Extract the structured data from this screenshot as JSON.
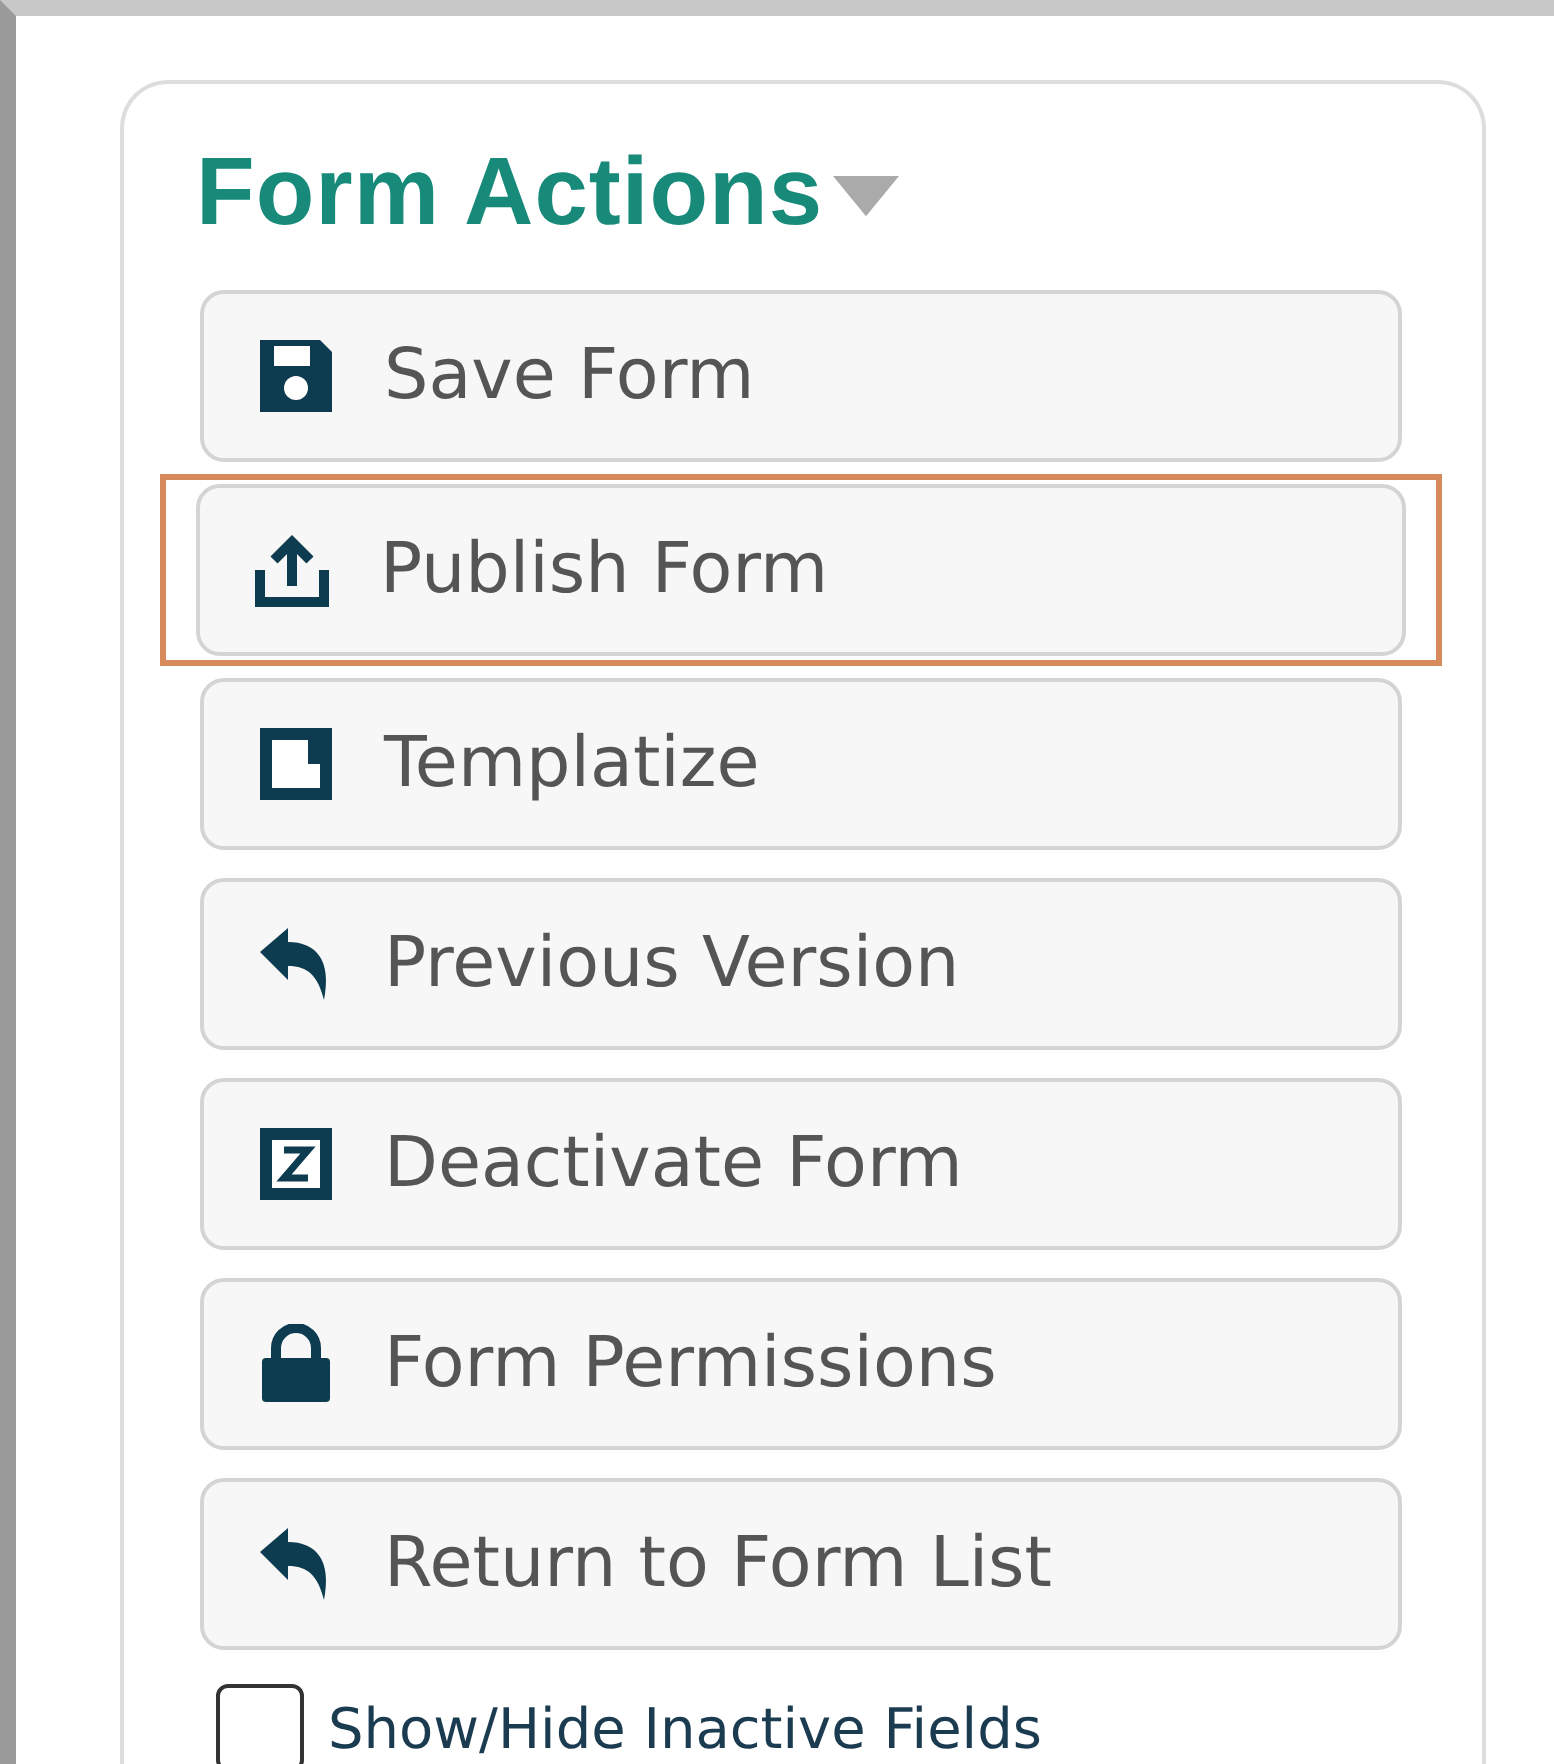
{
  "panel": {
    "title": "Form Actions",
    "buttons": [
      {
        "label": "Save Form",
        "kind": "save",
        "highlighted": false
      },
      {
        "label": "Publish Form",
        "kind": "publish",
        "highlighted": true
      },
      {
        "label": "Templatize",
        "kind": "template",
        "highlighted": false
      },
      {
        "label": "Previous Version",
        "kind": "revert",
        "highlighted": false
      },
      {
        "label": "Deactivate Form",
        "kind": "deactivate",
        "highlighted": false
      },
      {
        "label": "Form Permissions",
        "kind": "permissions",
        "highlighted": false
      },
      {
        "label": "Return to Form List",
        "kind": "revert",
        "highlighted": false
      }
    ],
    "checkbox": {
      "label": "Show/Hide Inactive Fields",
      "checked": false
    }
  }
}
